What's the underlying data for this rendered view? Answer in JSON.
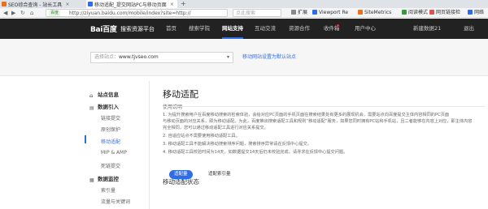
{
  "browser": {
    "tabs": [
      {
        "title": "SEO综合查询 - 站长工具"
      },
      {
        "title": "移动适配_提交网站PC与移动页面"
      }
    ],
    "tab_close": "×",
    "new_tab": "+",
    "address": {
      "badge": "百度",
      "url": "http://ziyuan.baidu.com/mobile/index?site=http://",
      "search_placeholder": "点此搜索"
    },
    "bookmarks": [
      "扩展",
      "Viewport Re",
      "SiteMetrics",
      "阅读模式",
      "网页链接检",
      "网络"
    ]
  },
  "topnav": {
    "logo": "Bai百度",
    "brand": "搜索资源平台",
    "items": [
      "首页",
      "搜索学院",
      "网站支持",
      "互动交流",
      "资源合作",
      "用户中心"
    ],
    "active_index": 2,
    "messages": "收件箱",
    "user": "新建数据21",
    "logout": "退出"
  },
  "sitebar": {
    "label": "选择站点：",
    "site": "www.tjvseo.com",
    "chevron": "▾",
    "link": "移动网站设置为默认站点"
  },
  "sidebar": {
    "groups": [
      {
        "label": "站点信息",
        "icon": "home-icon"
      },
      {
        "label": "数据引入",
        "icon": "import-icon"
      },
      {
        "label": "数据监控",
        "icon": "monitor-icon"
      }
    ],
    "items": [
      "链接提交",
      "原创保护",
      "移动适配",
      "MIP & AMP",
      "死链提交",
      "索引量",
      "流量与关键词"
    ],
    "active_item": "移动适配"
  },
  "main": {
    "title": "移动适配",
    "section": "使用说明",
    "paragraphs": [
      "1. 为提升搜索用户在百度移动搜索的检索体验，会给对应PC页面的手机页面在搜索结果处有更多的展现机会，需要站点向百度提交主体内容相同的PC页面",
      "与移动页面的对应关系，即为移动适配。为此，百度推出搜索适配工具和规则“移动适配”服务，如果您同时拥有PC站和手机站，且二者能够在内容上对应，即主体内容",
      "完全相同，您可以通过移动适配工具进行对应关系提交。",
      "2. 自适应站点不需要使用移动适配工具。",
      "3. 移动适配工具不能解决移动搜索排序问题，搜索排序异常请在反馈中心提交。",
      "4. 移动适配工具校验时间为14天，如数据提交14天后仍未校验完成，请寻求在反馈中心提交问题。"
    ],
    "status_title": "移动适配状态",
    "tabs": {
      "active": "适配量",
      "other": "适配索引量"
    }
  }
}
